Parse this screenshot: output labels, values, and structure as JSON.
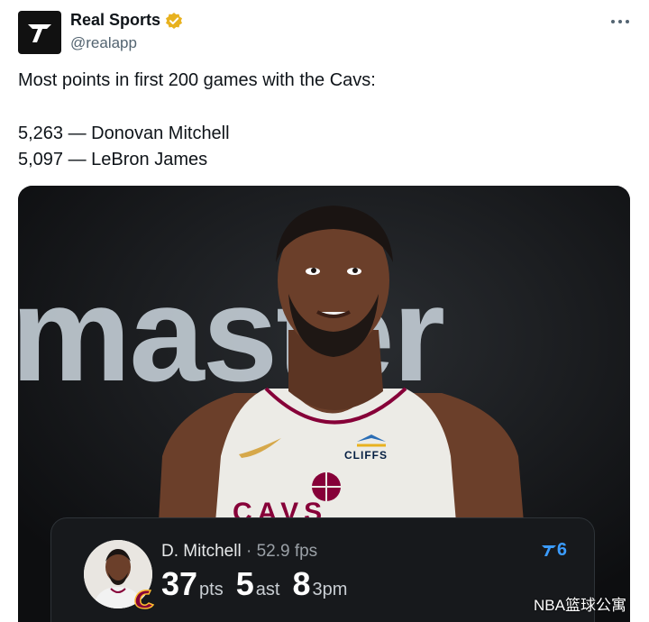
{
  "account": {
    "display_name": "Real Sports",
    "handle": "@realapp"
  },
  "tweet": {
    "line1": "Most points in first 200 games with the Cavs:",
    "line2": "5,263 — Donovan Mitchell",
    "line3": "5,097 — LeBron James"
  },
  "media": {
    "banner_text": "master",
    "jersey_sponsor": "CLIFFS",
    "jersey_text": "CAVS"
  },
  "stat_card": {
    "player": "D. Mitchell",
    "separator": "·",
    "fps": "52.9 fps",
    "points": "37",
    "points_unit": "pts",
    "assists": "5",
    "assists_unit": "ast",
    "threes": "8",
    "threes_unit": "3pm",
    "app_count": "6"
  },
  "watermark": "NBA篮球公寓",
  "colors": {
    "verified": "#e8b21f",
    "accent_blue": "#3b9cff",
    "card_bg": "#17191c",
    "cavs_wine": "#860038"
  }
}
